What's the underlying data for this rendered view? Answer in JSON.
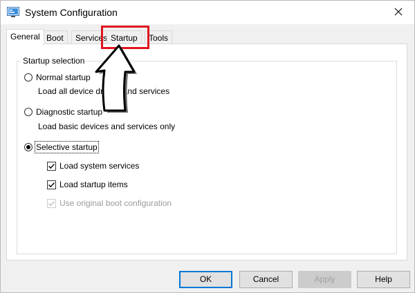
{
  "window": {
    "title": "System Configuration",
    "close_icon": "close-icon",
    "app_icon": "system-configuration-icon"
  },
  "tabs": [
    {
      "label": "General",
      "active": true
    },
    {
      "label": "Boot",
      "active": false
    },
    {
      "label": "Services",
      "active": false
    },
    {
      "label": "Startup",
      "active": false,
      "highlighted": true
    },
    {
      "label": "Tools",
      "active": false
    }
  ],
  "startup_selection": {
    "legend": "Startup selection",
    "options": [
      {
        "label": "Normal startup",
        "description": "Load all device drivers and services",
        "selected": false
      },
      {
        "label": "Diagnostic startup",
        "description": "Load basic devices and services only",
        "selected": false
      },
      {
        "label": "Selective startup",
        "description": "",
        "selected": true
      }
    ],
    "selective_items": [
      {
        "label": "Load system services",
        "checked": true,
        "enabled": true
      },
      {
        "label": "Load startup items",
        "checked": true,
        "enabled": true
      },
      {
        "label": "Use original boot configuration",
        "checked": true,
        "enabled": false
      }
    ]
  },
  "buttons": {
    "ok": "OK",
    "cancel": "Cancel",
    "apply": "Apply",
    "help": "Help"
  },
  "annotation": {
    "highlight_color": "#e0141e",
    "arrow_icon": "up-arrow-icon"
  }
}
